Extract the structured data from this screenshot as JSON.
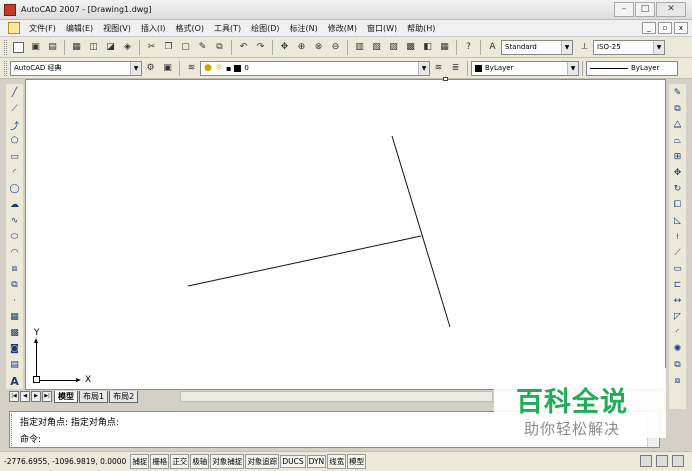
{
  "window": {
    "title": "AutoCAD 2007 - [Drawing1.dwg]",
    "min": "–",
    "max": "□",
    "close": "✕"
  },
  "menu": {
    "items": [
      {
        "label": "文件(F)"
      },
      {
        "label": "编辑(E)"
      },
      {
        "label": "视图(V)"
      },
      {
        "label": "插入(I)"
      },
      {
        "label": "格式(O)"
      },
      {
        "label": "工具(T)"
      },
      {
        "label": "绘图(D)"
      },
      {
        "label": "标注(N)"
      },
      {
        "label": "修改(M)"
      },
      {
        "label": "窗口(W)"
      },
      {
        "label": "帮助(H)"
      }
    ],
    "mdi": [
      "_",
      "▫",
      "x"
    ]
  },
  "toolbar": {
    "text_style": "Standard",
    "dim_style": "ISO-25",
    "workspace": "AutoCAD 经典",
    "layer": "0",
    "color": "ByLayer",
    "linetype": "ByLayer",
    "lineweight": "ByLayer"
  },
  "canvas": {
    "ucs_y": "Y",
    "ucs_x": "X",
    "lines": [
      "line-a",
      "line-b"
    ]
  },
  "layout_tabs": [
    "模型",
    "布局1",
    "布局2"
  ],
  "command": {
    "history": "指定对角点: 指定对角点:",
    "prompt": "命令:"
  },
  "status": {
    "coords": "-2776.6955, -1096.9819, 0.0000",
    "buttons": [
      "捕捉",
      "栅格",
      "正交",
      "极轴",
      "对象捕捉",
      "对象追踪",
      "DUCS",
      "DYN",
      "线宽",
      "模型"
    ]
  },
  "watermark": {
    "main": "百科全说",
    "sub": "助你轻松解决"
  }
}
